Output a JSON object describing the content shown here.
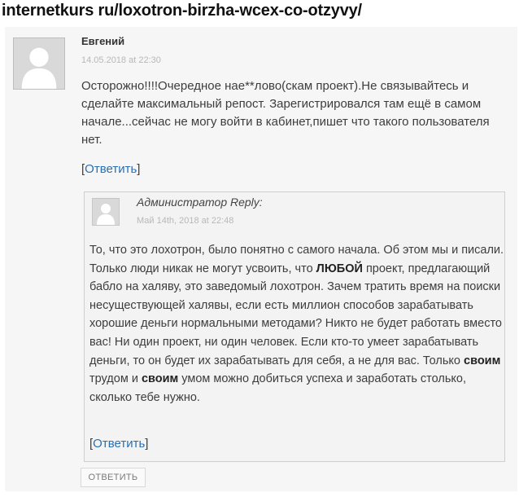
{
  "header": {
    "url": "internetkurs ru/loxotron-birzha-wcex-co-otzyvy/"
  },
  "comment": {
    "author": "Евгений",
    "date": "14.05.2018 at 22:30",
    "text": "Осторожно!!!!Очередное нае**лово(скам проект).Не связывайтесь и сделайте максимальный репост. Зарегистрировался там ещё в самом начале...сейчас не могу войти в кабинет,пишет что такого пользователя нет.",
    "reply_open": "[",
    "reply_label": "Ответить",
    "reply_close": "]"
  },
  "reply": {
    "author": "Администратор Reply:",
    "date": "Май 14th, 2018 at 22:48",
    "text": [
      "То, что это лохотрон, было понятно с самого начала. Об этом мы и писали. Только люди никак не могут усвоить, что ",
      "ЛЮБОЙ",
      " проект, предлагающий бабло на халяву, это заведомый лохотрон. Зачем тратить время на поиски несуществующей халявы, если есть миллион способов зарабатывать хорошие деньги нормальными методами? Никто не будет работать вместо вас! Ни один проект, ни один человек. Если кто-то умеет зарабатывать деньги, то он будет их зарабатывать для себя, а не для вас. Только ",
      "своим",
      " трудом и ",
      "своим",
      " умом можно добиться успеха и заработать столько, сколько тебе нужно."
    ],
    "reply_open": "[",
    "reply_label": "Ответить",
    "reply_close": "]"
  },
  "reply_button": {
    "label": "ОТВЕТИТЬ"
  },
  "icons": {
    "avatar": "user-silhouette-icon"
  }
}
